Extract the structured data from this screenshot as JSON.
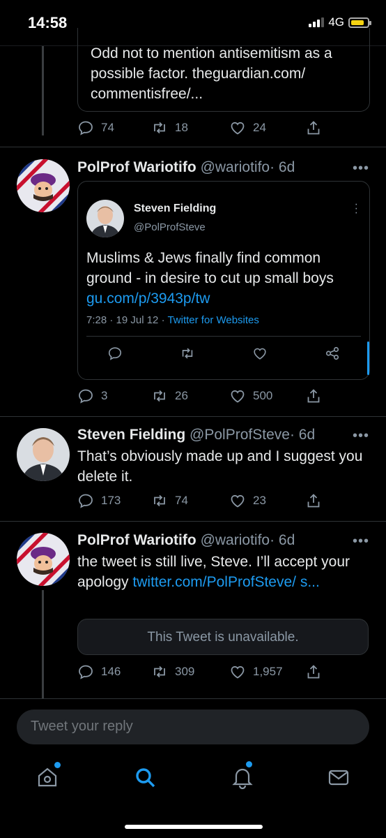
{
  "status": {
    "time": "14:58",
    "network": "4G"
  },
  "tweets": [
    {
      "text": "Odd not to mention antisemitism as a possible factor. theguardian.com/ commentisfree/...",
      "replies": "74",
      "retweets": "18",
      "likes": "24"
    },
    {
      "name": "PolProf Wariotifo",
      "handle": "@wariotifo",
      "time": "· 6d",
      "quoted": {
        "name": "Steven Fielding",
        "handle": "@PolProfSteve",
        "text": "Muslims & Jews finally find common ground - in desire to cut up small boys",
        "link": "gu.com/p/3943p/tw",
        "meta": "7:28 · 19 Jul 12 · ",
        "source": "Twitter for Websites"
      },
      "replies": "3",
      "retweets": "26",
      "likes": "500"
    },
    {
      "name": "Steven Fielding",
      "handle": "@PolProfSteve",
      "time": "· 6d",
      "text": "That’s obviously made up and I suggest you delete it.",
      "replies": "173",
      "retweets": "74",
      "likes": "23"
    },
    {
      "name": "PolProf Wariotifo",
      "handle": "@wariotifo",
      "time": "· 6d",
      "text": "the tweet is still live, Steve. I’ll accept your apology ",
      "link": "twitter.com/PolProfSteve/ s...",
      "unavailable": "This Tweet is unavailable.",
      "replies": "146",
      "retweets": "309",
      "likes": "1,957"
    }
  ],
  "composer": {
    "placeholder": "Tweet your reply"
  },
  "nav": [
    "home-icon",
    "search-icon",
    "notifications-icon",
    "messages-icon"
  ],
  "colors": {
    "accent": "#1d9bf0",
    "background": "#000000",
    "battery": "#f5d312"
  },
  "more_glyph": "•••"
}
